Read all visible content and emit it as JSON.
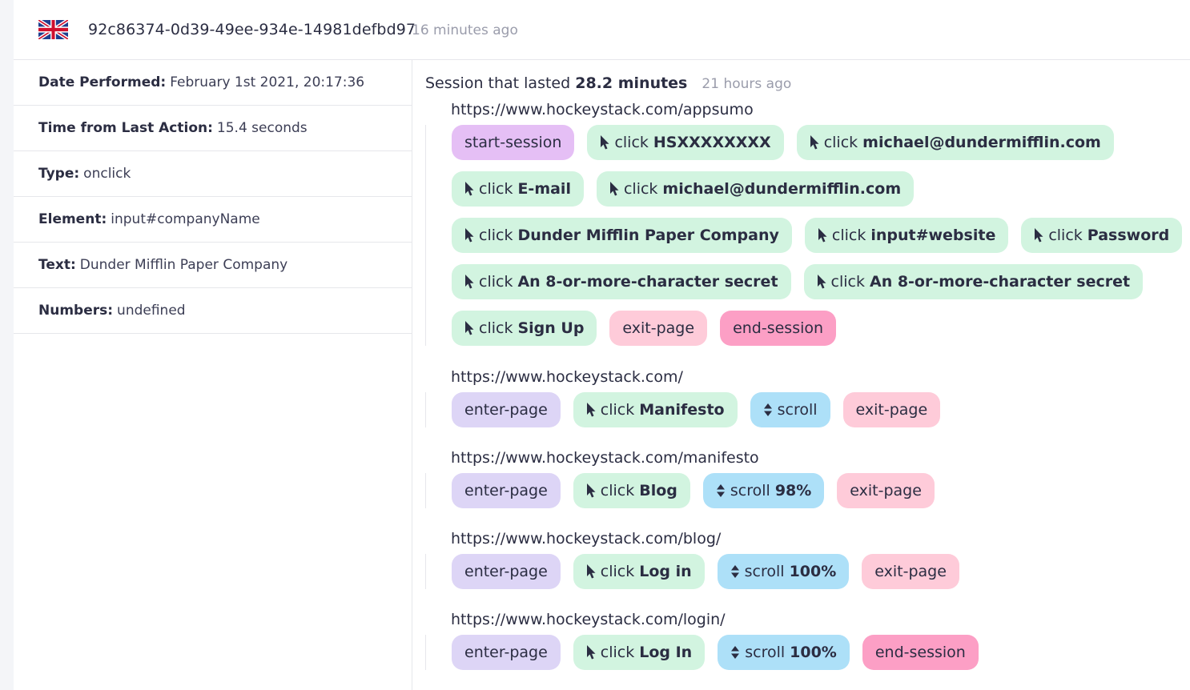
{
  "header": {
    "flag_icon": "uk-flag-icon",
    "session_id": "92c86374-0d39-49ee-934e-14981defbd97",
    "time_ago": "16 minutes ago"
  },
  "details": [
    {
      "key": "Date Performed:",
      "value": "February 1st 2021, 20:17:36"
    },
    {
      "key": "Time from Last Action:",
      "value": "15.4 seconds"
    },
    {
      "key": "Type:",
      "value": "onclick"
    },
    {
      "key": "Element:",
      "value": "input#companyName"
    },
    {
      "key": "Text:",
      "value": "Dunder Mifflin Paper Company"
    },
    {
      "key": "Numbers:",
      "value": "undefined"
    }
  ],
  "session": {
    "prefix": "Session that lasted",
    "duration": "28.2 minutes",
    "time_ago": "21 hours ago"
  },
  "colors": {
    "start_session": "#e5bff5",
    "click": "#d2f4e0",
    "exit_page": "#fecbd9",
    "end_session": "#fc9fc5",
    "enter_page": "#ddd5f6",
    "scroll": "#ade0f8"
  },
  "pages": [
    {
      "url": "https://www.hockeystack.com/appsumo",
      "lines": [
        [
          {
            "type": "start",
            "label": "start-session"
          },
          {
            "type": "click",
            "label": "click",
            "detail": "HSXXXXXXXX"
          },
          {
            "type": "click",
            "label": "click",
            "detail": "michael@dundermifflin.com"
          }
        ],
        [
          {
            "type": "click",
            "label": "click",
            "detail": "E-mail"
          },
          {
            "type": "click",
            "label": "click",
            "detail": "michael@dundermifflin.com"
          }
        ],
        [
          {
            "type": "click",
            "label": "click",
            "detail": "Dunder Mifflin Paper Company"
          },
          {
            "type": "click",
            "label": "click",
            "detail": "input#website"
          },
          {
            "type": "click",
            "label": "click",
            "detail": "Password"
          }
        ],
        [
          {
            "type": "click",
            "label": "click",
            "detail": "An 8-or-more-character secret"
          },
          {
            "type": "click",
            "label": "click",
            "detail": "An 8-or-more-character secret"
          }
        ],
        [
          {
            "type": "click",
            "label": "click",
            "detail": "Sign Up"
          },
          {
            "type": "exit",
            "label": "exit-page"
          },
          {
            "type": "end",
            "label": "end-session"
          }
        ]
      ]
    },
    {
      "url": "https://www.hockeystack.com/",
      "lines": [
        [
          {
            "type": "enter",
            "label": "enter-page"
          },
          {
            "type": "click",
            "label": "click",
            "detail": "Manifesto"
          },
          {
            "type": "scroll",
            "label": "scroll"
          },
          {
            "type": "exit",
            "label": "exit-page"
          }
        ]
      ]
    },
    {
      "url": "https://www.hockeystack.com/manifesto",
      "lines": [
        [
          {
            "type": "enter",
            "label": "enter-page"
          },
          {
            "type": "click",
            "label": "click",
            "detail": "Blog"
          },
          {
            "type": "scroll",
            "label": "scroll",
            "detail": "98%"
          },
          {
            "type": "exit",
            "label": "exit-page"
          }
        ]
      ]
    },
    {
      "url": "https://www.hockeystack.com/blog/",
      "lines": [
        [
          {
            "type": "enter",
            "label": "enter-page"
          },
          {
            "type": "click",
            "label": "click",
            "detail": "Log in"
          },
          {
            "type": "scroll",
            "label": "scroll",
            "detail": "100%"
          },
          {
            "type": "exit",
            "label": "exit-page"
          }
        ]
      ]
    },
    {
      "url": "https://www.hockeystack.com/login/",
      "lines": [
        [
          {
            "type": "enter",
            "label": "enter-page"
          },
          {
            "type": "click",
            "label": "click",
            "detail": "Log In"
          },
          {
            "type": "scroll",
            "label": "scroll",
            "detail": "100%"
          },
          {
            "type": "end",
            "label": "end-session"
          }
        ]
      ]
    }
  ]
}
